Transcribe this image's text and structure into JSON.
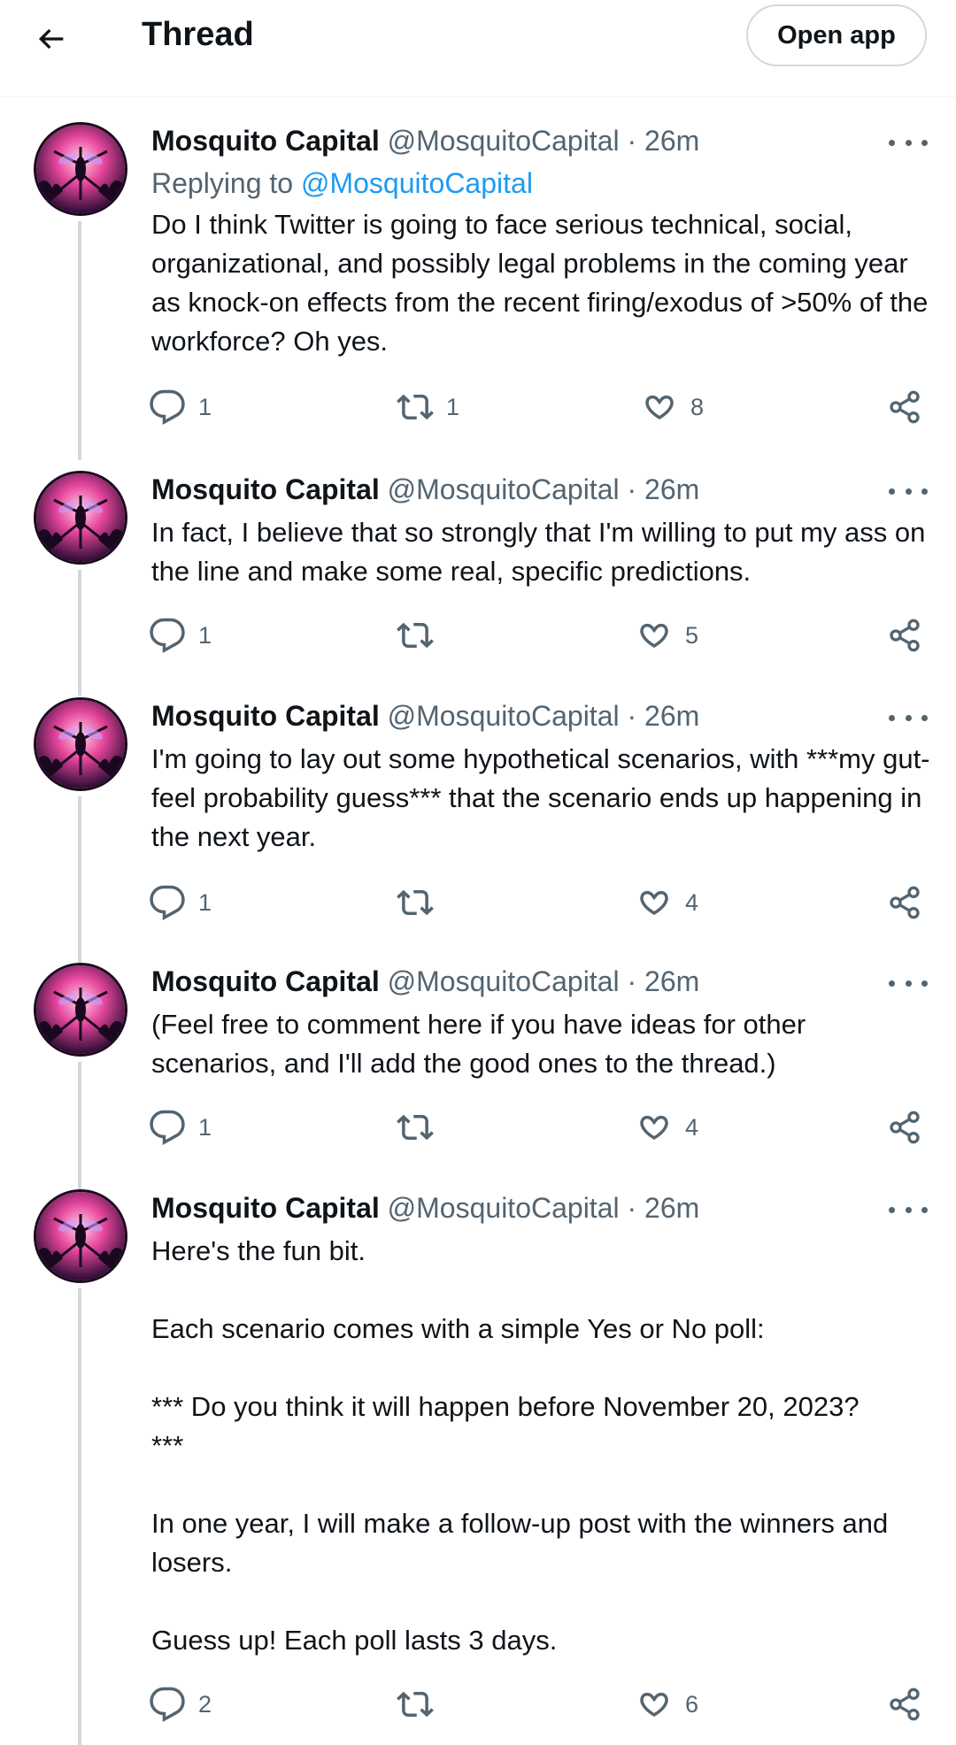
{
  "header": {
    "title": "Thread",
    "open_app_label": "Open app",
    "back_icon": "arrow-left-icon"
  },
  "tweets": [
    {
      "author": "Mosquito Capital",
      "handle": "@MosquitoCapital",
      "time": "· 26m",
      "replying_prefix": "Replying to ",
      "replying_to": "@MosquitoCapital",
      "text": "Do I think Twitter is going to face serious technical, social, organizational, and possibly legal problems in the coming year as knock-on effects from the recent firing/exodus of >50% of the workforce? Oh yes.",
      "replies": "1",
      "retweets": "1",
      "likes": "8"
    },
    {
      "author": "Mosquito Capital",
      "handle": "@MosquitoCapital",
      "time": "· 26m",
      "text": "In fact, I believe that so strongly that I'm willing to put my ass on the line and make some real, specific predictions.",
      "replies": "1",
      "retweets": "",
      "likes": "5"
    },
    {
      "author": "Mosquito Capital",
      "handle": "@MosquitoCapital",
      "time": "· 26m",
      "text": "I'm going to lay out some hypothetical scenarios, with ***my gut-feel probability guess*** that the scenario ends up happening in the next year.",
      "replies": "1",
      "retweets": "",
      "likes": "4"
    },
    {
      "author": "Mosquito Capital",
      "handle": "@MosquitoCapital",
      "time": "· 26m",
      "text": "(Feel free to comment here if you have ideas for other scenarios, and I'll add the good ones to the thread.)",
      "replies": "1",
      "retweets": "",
      "likes": "4"
    },
    {
      "author": "Mosquito Capital",
      "handle": "@MosquitoCapital",
      "time": "· 26m",
      "text": "Here's the fun bit.\n\nEach scenario comes with a simple Yes or No poll:\n\n*** Do you think it will happen before November 20, 2023?\n***\n\nIn one year, I will make a follow-up post with the winners and losers.\n\nGuess up! Each poll lasts 3 days.",
      "replies": "2",
      "retweets": "",
      "likes": "6"
    }
  ],
  "icons": {
    "reply": "reply-bubble-icon",
    "retweet": "retweet-icon",
    "like": "heart-icon",
    "share": "share-icon",
    "more": "more-dots-icon"
  },
  "colors": {
    "link": "#1d9bf0",
    "secondary_text": "#536471",
    "thread_line": "#cfd9de"
  }
}
